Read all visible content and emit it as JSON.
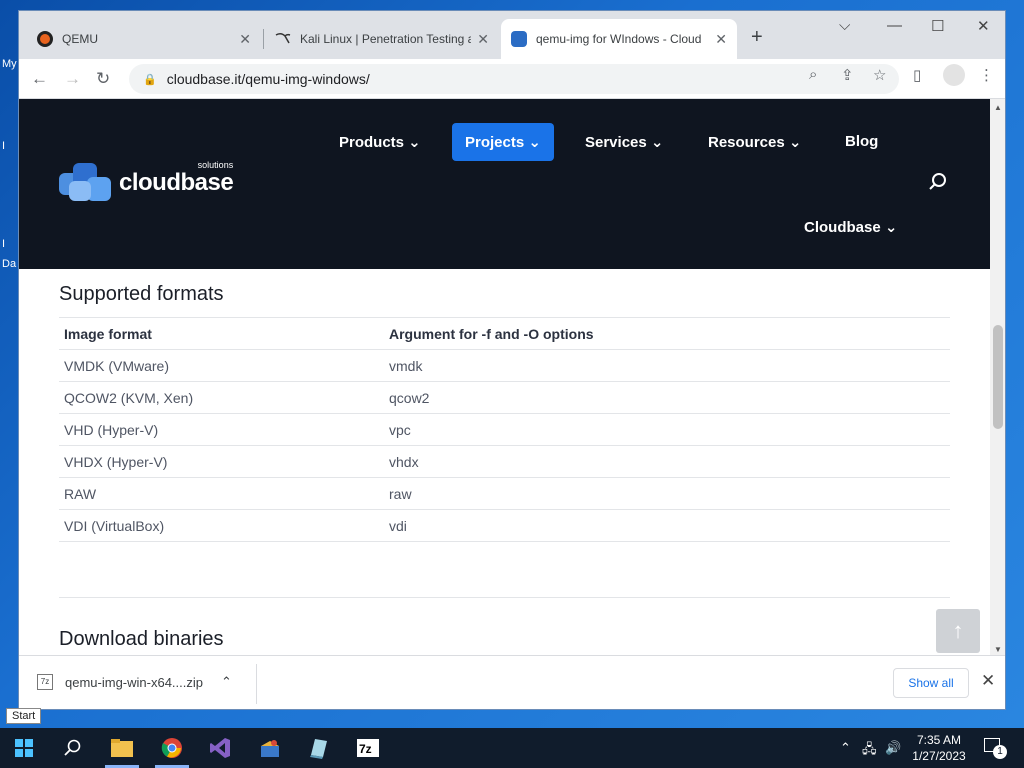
{
  "desktop": {
    "labels": [
      "My",
      "I",
      "I",
      "Da"
    ]
  },
  "browser": {
    "tabs": [
      {
        "title": "QEMU",
        "close": "✕"
      },
      {
        "title": "Kali Linux | Penetration Testing an",
        "close": "✕"
      },
      {
        "title": "qemu-img for WIndows - Cloud",
        "close": "✕"
      }
    ],
    "new_tab": "+",
    "address": "cloudbase.it/qemu-img-windows/"
  },
  "site": {
    "logo_name": "cloudbase",
    "logo_sup": "solutions",
    "nav": {
      "products": "Products",
      "projects": "Projects",
      "services": "Services",
      "resources": "Resources",
      "blog": "Blog",
      "cloudbase": "Cloudbase"
    },
    "supported_formats": {
      "heading": "Supported formats",
      "columns": [
        "Image format",
        "Argument for -f and -O options"
      ],
      "rows": [
        [
          "VMDK (VMware)",
          "vmdk"
        ],
        [
          "QCOW2 (KVM, Xen)",
          "qcow2"
        ],
        [
          "VHD (Hyper-V)",
          "vpc"
        ],
        [
          "VHDX (Hyper-V)",
          "vhdx"
        ],
        [
          "RAW",
          "raw"
        ],
        [
          "VDI (VirtualBox)",
          "vdi"
        ]
      ]
    },
    "download_heading": "Download binaries"
  },
  "downloads": {
    "file": "qemu-img-win-x64....zip",
    "show_all": "Show all"
  },
  "tooltip": "Start",
  "clock": {
    "time": "7:35 AM",
    "date": "1/27/2023"
  },
  "notifications_count": "1",
  "colors": {
    "accent": "#1a73e8",
    "nav_bg": "#0f1520",
    "taskbar": "#101c2c"
  }
}
